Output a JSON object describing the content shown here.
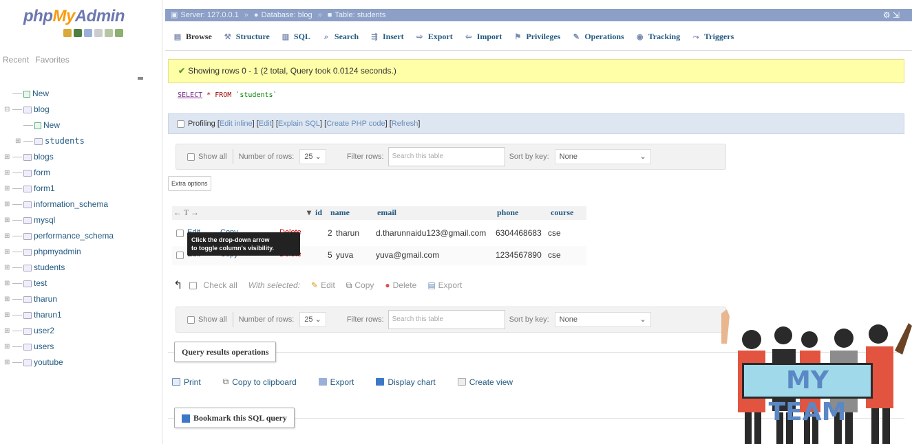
{
  "logo": {
    "php": "php",
    "my": "My",
    "admin": "Admin"
  },
  "nav_panel": {
    "recent": "Recent",
    "favorites": "Favorites"
  },
  "tree": [
    {
      "label": "New",
      "type": "new",
      "level": 0
    },
    {
      "label": "blog",
      "type": "db",
      "level": 0
    },
    {
      "label": "New",
      "type": "new",
      "level": 1
    },
    {
      "label": "students",
      "type": "table",
      "level": 1
    },
    {
      "label": "blogs",
      "type": "db",
      "level": 0
    },
    {
      "label": "form",
      "type": "db",
      "level": 0
    },
    {
      "label": "form1",
      "type": "db",
      "level": 0
    },
    {
      "label": "information_schema",
      "type": "db",
      "level": 0
    },
    {
      "label": "mysql",
      "type": "db",
      "level": 0
    },
    {
      "label": "performance_schema",
      "type": "db",
      "level": 0
    },
    {
      "label": "phpmyadmin",
      "type": "db",
      "level": 0
    },
    {
      "label": "students",
      "type": "db",
      "level": 0
    },
    {
      "label": "test",
      "type": "db",
      "level": 0
    },
    {
      "label": "tharun",
      "type": "db",
      "level": 0
    },
    {
      "label": "tharun1",
      "type": "db",
      "level": 0
    },
    {
      "label": "user2",
      "type": "db",
      "level": 0
    },
    {
      "label": "users",
      "type": "db",
      "level": 0
    },
    {
      "label": "youtube",
      "type": "db",
      "level": 0
    }
  ],
  "breadcrumb": {
    "server": "Server: 127.0.0.1",
    "database": "Database: blog",
    "table": "Table: students"
  },
  "tabs": [
    "Browse",
    "Structure",
    "SQL",
    "Search",
    "Insert",
    "Export",
    "Import",
    "Privileges",
    "Operations",
    "Tracking",
    "Triggers"
  ],
  "success_message": "Showing rows 0 - 1 (2 total, Query took 0.0124 seconds.)",
  "sql": {
    "select": "SELECT",
    "star": "*",
    "from": "FROM",
    "table": "`students`"
  },
  "profiling": {
    "label": "Profiling",
    "links": [
      "Edit inline",
      "Edit",
      "Explain SQL",
      "Create PHP code",
      "Refresh"
    ]
  },
  "nav": {
    "show_all": "Show all",
    "number_of_rows": "Number of rows:",
    "rows_value": "25",
    "filter_rows": "Filter rows:",
    "filter_placeholder": "Search this table",
    "sort_by_key": "Sort by key:",
    "sort_value": "None"
  },
  "extra_options": "Extra options",
  "table": {
    "columns": [
      "id",
      "name",
      "email",
      "phone",
      "course"
    ],
    "rows": [
      {
        "id": "2",
        "name": "tharun",
        "email": "d.tharunnaidu123@gmail.com",
        "phone": "6304468683",
        "course": "cse"
      },
      {
        "id": "5",
        "name": "yuva",
        "email": "yuva@gmail.com",
        "phone": "1234567890",
        "course": "cse"
      }
    ],
    "row_actions": {
      "edit": "Edit",
      "copy": "Copy",
      "delete": "Delete"
    }
  },
  "tooltip": {
    "line1": "Click the drop-down arrow",
    "line2": "to toggle column's visibility."
  },
  "bulk": {
    "check_all": "Check all",
    "with_selected": "With selected:",
    "edit": "Edit",
    "copy": "Copy",
    "delete": "Delete",
    "export": "Export"
  },
  "query_ops": {
    "legend": "Query results operations",
    "items": [
      "Print",
      "Copy to clipboard",
      "Export",
      "Display chart",
      "Create view"
    ]
  },
  "bookmark": {
    "legend": "Bookmark this SQL query"
  },
  "overlay": {
    "sign_text": "MY TEAM"
  },
  "colors": {
    "link": "#235a81",
    "success_bg": "#ffffa8",
    "topbar": "#8b9fc7",
    "logo_orange": "#f89c0e",
    "logo_blue": "#6c78af"
  }
}
